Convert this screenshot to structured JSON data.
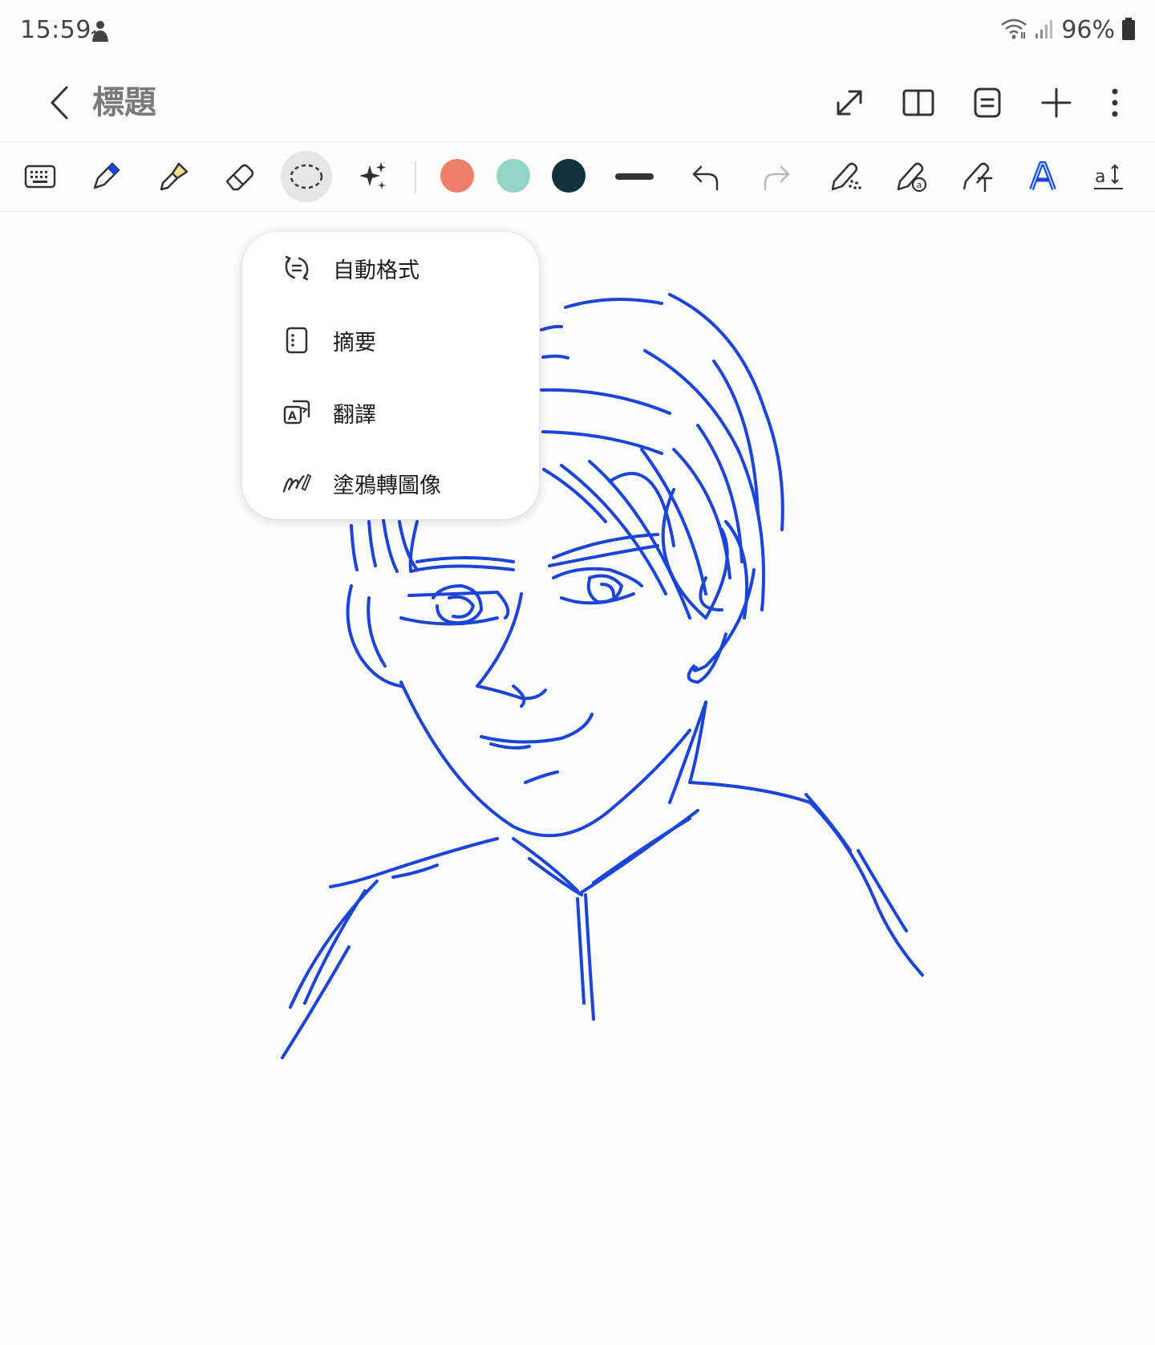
{
  "status_bar": {
    "time": "15:59",
    "battery": "96%",
    "icons": [
      "sync-person-icon",
      "wifi-icon",
      "signal-icon",
      "battery-icon"
    ]
  },
  "app_bar": {
    "title": "標題",
    "actions": [
      "expand-icon",
      "book-view-icon",
      "page-list-icon",
      "add-icon",
      "more-icon"
    ]
  },
  "toolbar": {
    "tools": [
      "keyboard-icon",
      "pen-icon",
      "highlighter-icon",
      "eraser-icon",
      "lasso-select-icon",
      "ai-sparkle-icon"
    ],
    "active_tool": "lasso-select-icon",
    "colors": [
      "#ef7f68",
      "#93d6c8",
      "#10323b"
    ],
    "extra": [
      "stroke-width-icon",
      "undo-icon",
      "redo-icon",
      "shape-recognize-icon",
      "pen-assist-icon",
      "text-convert-icon",
      "pen-style-icon",
      "text-size-icon"
    ],
    "stroke_color": "#1b45d8"
  },
  "popup_menu": {
    "items": [
      {
        "label": "自動格式",
        "icon": "auto-format-icon"
      },
      {
        "label": "摘要",
        "icon": "summary-icon"
      },
      {
        "label": "翻譯",
        "icon": "translate-icon"
      },
      {
        "label": "塗鴉轉圖像",
        "icon": "sketch-to-image-icon"
      }
    ]
  }
}
